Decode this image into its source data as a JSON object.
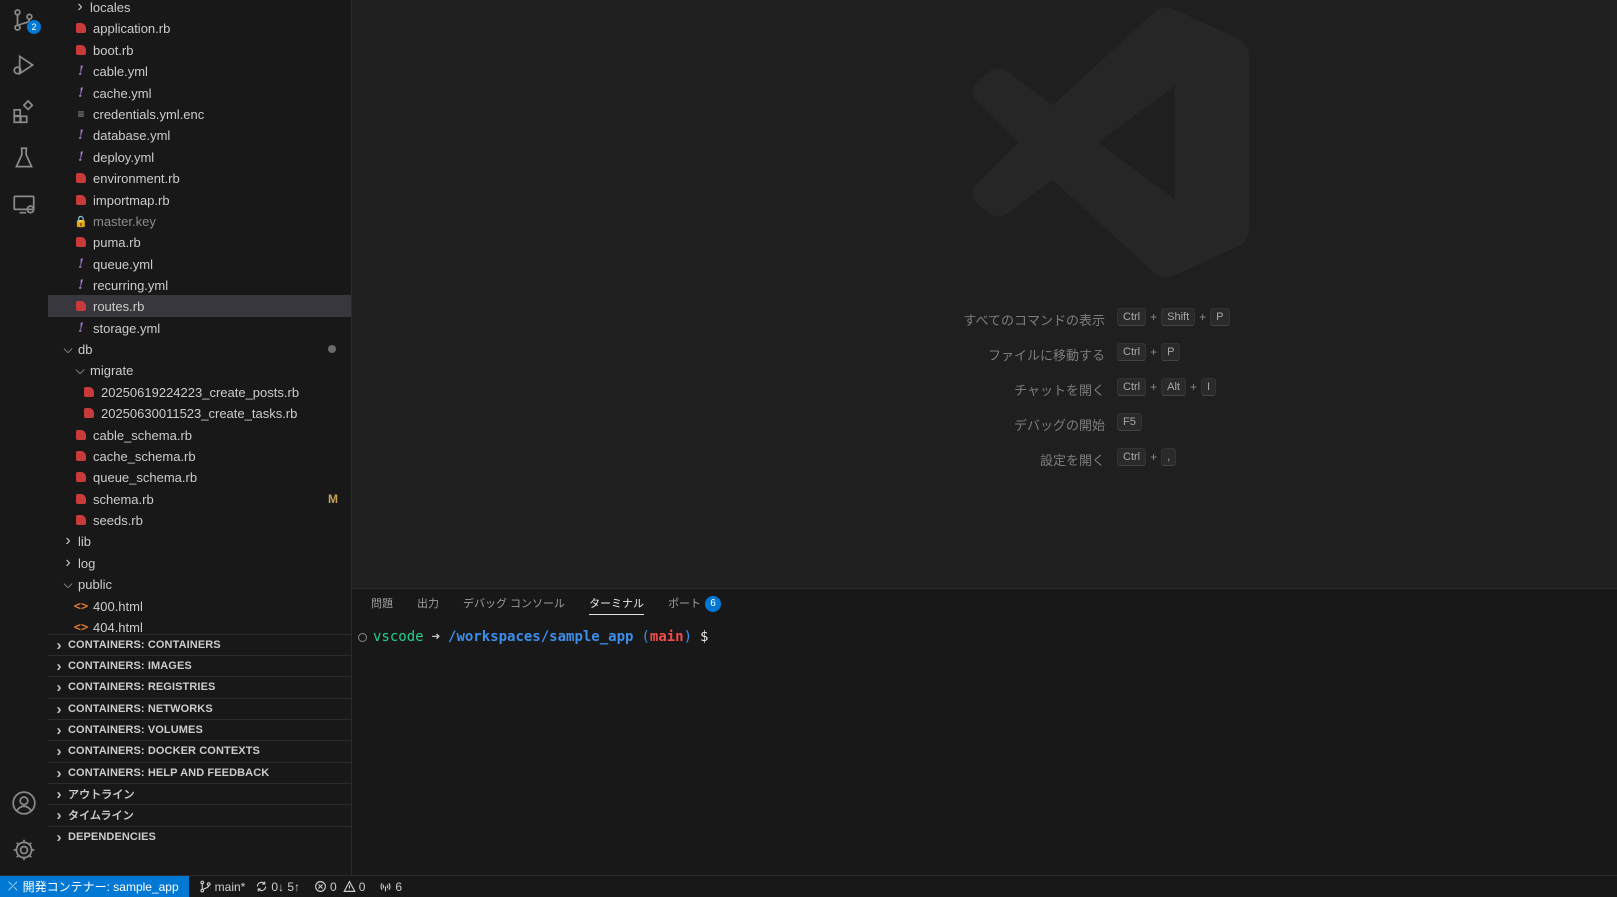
{
  "activity_bar": {
    "source_control_badge": "2"
  },
  "explorer": {
    "rows": [
      {
        "label": "locales",
        "kind": "folder-collapsed"
      },
      {
        "label": "application.rb",
        "kind": "ruby"
      },
      {
        "label": "boot.rb",
        "kind": "ruby"
      },
      {
        "label": "cable.yml",
        "kind": "yml"
      },
      {
        "label": "cache.yml",
        "kind": "yml"
      },
      {
        "label": "credentials.yml.enc",
        "kind": "enc"
      },
      {
        "label": "database.yml",
        "kind": "yml"
      },
      {
        "label": "deploy.yml",
        "kind": "yml"
      },
      {
        "label": "environment.rb",
        "kind": "ruby"
      },
      {
        "label": "importmap.rb",
        "kind": "ruby"
      },
      {
        "label": "master.key",
        "kind": "key"
      },
      {
        "label": "puma.rb",
        "kind": "ruby"
      },
      {
        "label": "queue.yml",
        "kind": "yml"
      },
      {
        "label": "recurring.yml",
        "kind": "yml"
      },
      {
        "label": "routes.rb",
        "kind": "ruby"
      },
      {
        "label": "storage.yml",
        "kind": "yml"
      },
      {
        "label": "db",
        "kind": "folder-expanded"
      },
      {
        "label": "migrate",
        "kind": "folder-expanded"
      },
      {
        "label": "20250619224223_create_posts.rb",
        "kind": "ruby"
      },
      {
        "label": "20250630011523_create_tasks.rb",
        "kind": "ruby"
      },
      {
        "label": "cable_schema.rb",
        "kind": "ruby"
      },
      {
        "label": "cache_schema.rb",
        "kind": "ruby"
      },
      {
        "label": "queue_schema.rb",
        "kind": "ruby"
      },
      {
        "label": "schema.rb",
        "kind": "ruby",
        "status": "M"
      },
      {
        "label": "seeds.rb",
        "kind": "ruby"
      },
      {
        "label": "lib",
        "kind": "folder-collapsed"
      },
      {
        "label": "log",
        "kind": "folder-collapsed"
      },
      {
        "label": "public",
        "kind": "folder-expanded"
      },
      {
        "label": "400.html",
        "kind": "html"
      },
      {
        "label": "404.html",
        "kind": "html"
      }
    ],
    "sections": [
      "CONTAINERS: CONTAINERS",
      "CONTAINERS: IMAGES",
      "CONTAINERS: REGISTRIES",
      "CONTAINERS: NETWORKS",
      "CONTAINERS: VOLUMES",
      "CONTAINERS: DOCKER CONTEXTS",
      "CONTAINERS: HELP AND FEEDBACK",
      "アウトライン",
      "タイムライン",
      "DEPENDENCIES"
    ]
  },
  "welcome": {
    "shortcuts": [
      {
        "label": "すべてのコマンドの表示",
        "keys": [
          "Ctrl",
          "Shift",
          "P"
        ]
      },
      {
        "label": "ファイルに移動する",
        "keys": [
          "Ctrl",
          "P"
        ]
      },
      {
        "label": "チャットを開く",
        "keys": [
          "Ctrl",
          "Alt",
          "I"
        ]
      },
      {
        "label": "デバッグの開始",
        "keys": [
          "F5"
        ]
      },
      {
        "label": "設定を開く",
        "keys": [
          "Ctrl",
          ","
        ]
      }
    ]
  },
  "panel": {
    "tabs": {
      "problems": "問題",
      "output": "出力",
      "debug_console": "デバッグ コンソール",
      "terminal": "ターミナル",
      "ports": "ポート",
      "ports_badge": "6"
    },
    "terminal": {
      "user": "vscode",
      "arrow": "➜",
      "path": "/workspaces/sample_app",
      "paren_open": "(",
      "branch": "main",
      "paren_close": ")",
      "prompt": "$"
    }
  },
  "statusbar": {
    "remote": "開発コンテナー: sample_app",
    "branch": "main*",
    "sync": "0↓ 5↑",
    "errors": "0",
    "warnings": "0",
    "ports": "6"
  }
}
